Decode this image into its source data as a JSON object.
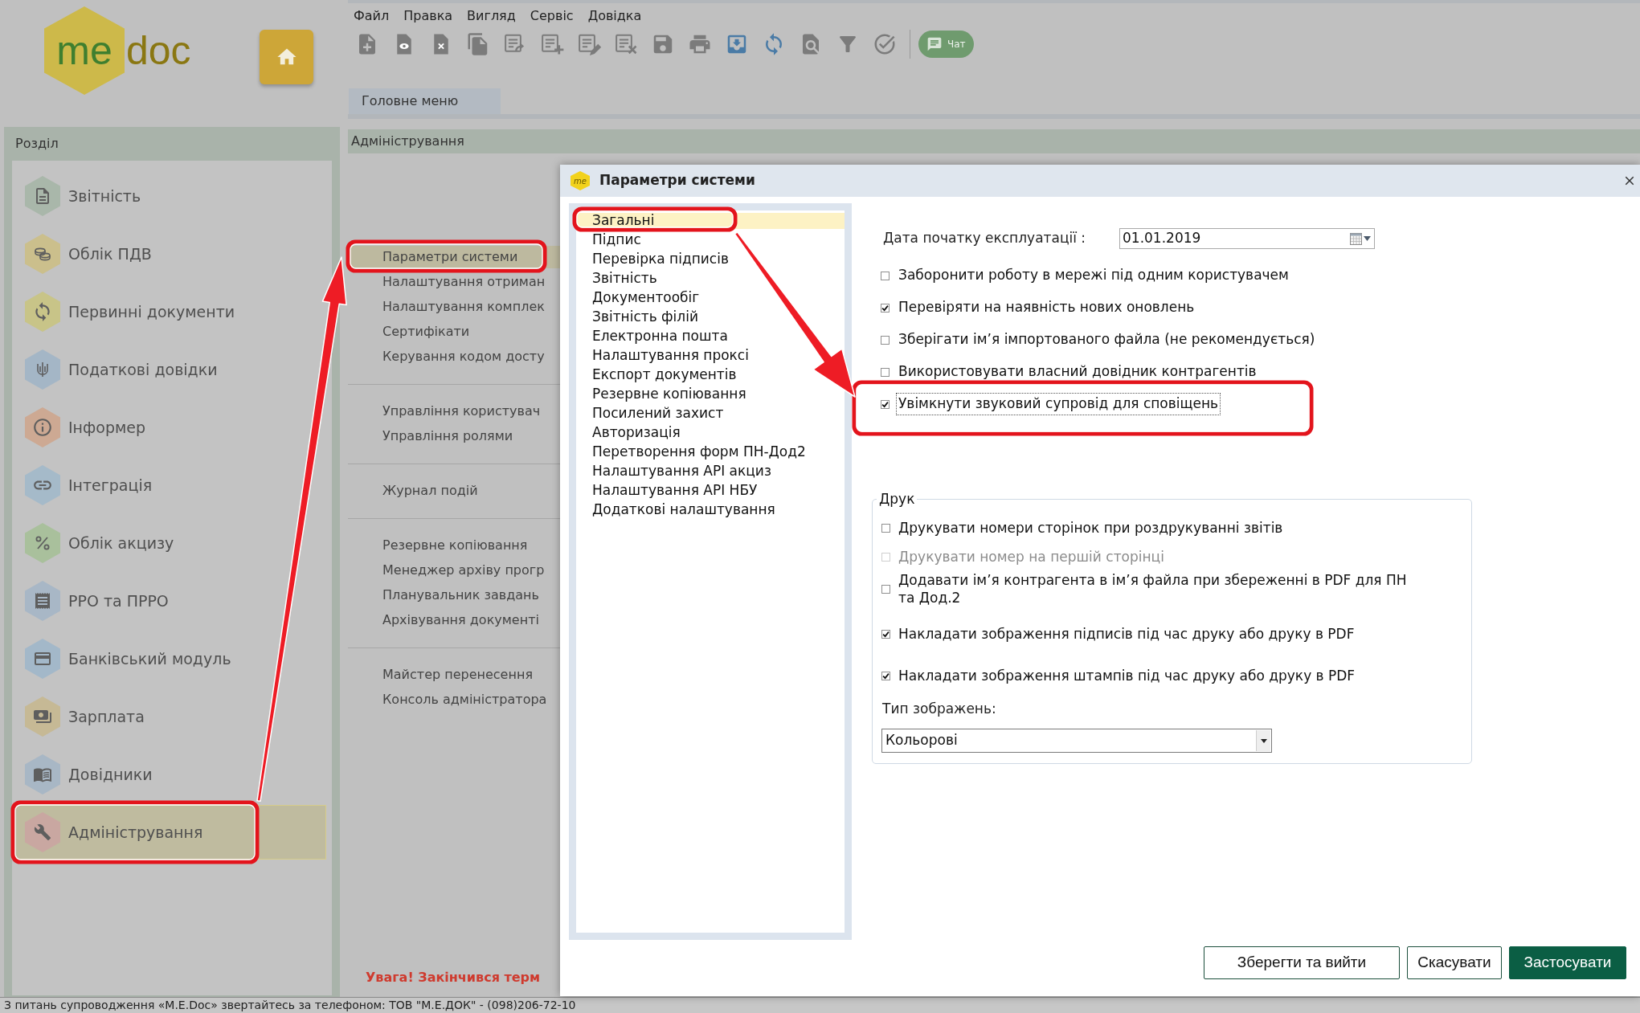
{
  "logo": {
    "text_1": "me",
    "text_2": "doc"
  },
  "menu_bar": [
    "Файл",
    "Правка",
    "Вигляд",
    "Сервіс",
    "Довідка"
  ],
  "toolbar": {
    "chat_button": "Чат"
  },
  "tabs": [
    {
      "label": "Головне меню",
      "selected": true
    }
  ],
  "sidebar": {
    "title": "Розділ",
    "items": [
      {
        "label": "Звітність",
        "selected": false,
        "color": "#a9b7aa"
      },
      {
        "label": "Облік ПДВ",
        "selected": false,
        "color": "#cbbf8c"
      },
      {
        "label": "Первинні документи",
        "selected": false,
        "color": "#c8c488"
      },
      {
        "label": "Податкові довідки",
        "selected": false,
        "color": "#a4b6c6"
      },
      {
        "label": "Інформер",
        "selected": false,
        "color": "#cda993"
      },
      {
        "label": "Інтеграція",
        "selected": false,
        "color": "#a5bac9"
      },
      {
        "label": "Облік акцизу",
        "selected": false,
        "color": "#a9c09c"
      },
      {
        "label": "РРО та ПРРО",
        "selected": false,
        "color": "#a8b7c6"
      },
      {
        "label": "Банківський модуль",
        "selected": false,
        "color": "#a3b8c9"
      },
      {
        "label": "Зарплата",
        "selected": false,
        "color": "#c6b995"
      },
      {
        "label": "Довідники",
        "selected": false,
        "color": "#a8b7c5"
      },
      {
        "label": "Адміністрування",
        "selected": true,
        "color": "#c9a7a1"
      }
    ]
  },
  "section_header": "Адміністрування",
  "admin_menu": {
    "groups": [
      {
        "items": [
          {
            "label": "Параметри системи",
            "selected": true
          },
          {
            "label": "Налаштування отриман",
            "selected": false
          },
          {
            "label": "Налаштування комплек",
            "selected": false
          },
          {
            "label": "Сертифікати",
            "selected": false
          },
          {
            "label": "Керування кодом досту",
            "selected": false
          }
        ]
      },
      {
        "items": [
          {
            "label": "Управління користувач",
            "selected": false
          },
          {
            "label": "Управління ролями",
            "selected": false
          }
        ]
      },
      {
        "items": [
          {
            "label": "Журнал подій",
            "selected": false
          }
        ]
      },
      {
        "items": [
          {
            "label": "Резервне копіювання",
            "selected": false
          },
          {
            "label": "Менеджер архіву прогр",
            "selected": false
          },
          {
            "label": "Планувальник завдань",
            "selected": false
          },
          {
            "label": "Архівування документі",
            "selected": false
          }
        ]
      },
      {
        "items": [
          {
            "label": "Майстер перенесення",
            "selected": false
          },
          {
            "label": "Консоль адміністратора",
            "selected": false
          }
        ]
      }
    ]
  },
  "warning": "Увага! Закінчився терм",
  "status_bar": "З питань супроводження «M.E.Doc» звертайтесь за телефоном: ТОВ \"М.Е.ДОК\" - (098)206-72-10",
  "dialog": {
    "icon_text": "me",
    "title": "Параметри системи",
    "categories": [
      {
        "label": "Загальні",
        "selected": true
      },
      {
        "label": "Підпис",
        "selected": false
      },
      {
        "label": "Перевірка підписів",
        "selected": false
      },
      {
        "label": "Звітність",
        "selected": false
      },
      {
        "label": "Документообіг",
        "selected": false
      },
      {
        "label": "Звітність філій",
        "selected": false
      },
      {
        "label": "Електронна пошта",
        "selected": false
      },
      {
        "label": "Налаштування проксі",
        "selected": false
      },
      {
        "label": "Експорт документів",
        "selected": false
      },
      {
        "label": "Резервне копіювання",
        "selected": false
      },
      {
        "label": "Посилений захист",
        "selected": false
      },
      {
        "label": "Авторизація",
        "selected": false
      },
      {
        "label": "Перетворення форм ПН-Дод2",
        "selected": false
      },
      {
        "label": "Налаштування API акциз",
        "selected": false
      },
      {
        "label": "Налаштування API НБУ",
        "selected": false
      },
      {
        "label": "Додаткові налаштування",
        "selected": false
      }
    ],
    "start_date": {
      "label": "Дата початку експлуатації :",
      "value": "01.01.2019"
    },
    "options": [
      {
        "label": "Заборонити роботу в мережі під одним користувачем",
        "checked": false,
        "focused": false
      },
      {
        "label": "Перевіряти на наявність нових оновлень",
        "checked": true,
        "focused": false
      },
      {
        "label": "Зберігати ім’я імпортованого файла (не рекомендується)",
        "checked": false,
        "focused": false
      },
      {
        "label": "Використовувати власний довідник контрагентів",
        "checked": false,
        "focused": false
      },
      {
        "label": "Увімкнути звуковий супровід для сповіщень",
        "checked": true,
        "focused": true
      }
    ],
    "print_group": {
      "title": "Друк",
      "options": [
        {
          "label": "Друкувати номери сторінок при роздрукуванні звітів",
          "checked": false,
          "disabled": false
        },
        {
          "label": "Друкувати номер на першій сторінці",
          "checked": false,
          "disabled": true
        },
        {
          "label": "Додавати ім’я контрагента в ім’я файла при збереженні в PDF для ПН та Дод.2",
          "checked": false,
          "disabled": false
        },
        {
          "label": "Накладати зображення підписів під час друку або друку в PDF",
          "checked": true,
          "disabled": false
        },
        {
          "label": "Накладати зображення штампів під час друку або друку в PDF",
          "checked": true,
          "disabled": false
        }
      ],
      "image_type": {
        "label": "Тип зображень:",
        "value": "Кольорові"
      }
    },
    "buttons": [
      {
        "label": "Зберегти та вийти",
        "kind": "secondary"
      },
      {
        "label": "Скасувати",
        "kind": "secondary"
      },
      {
        "label": "Застосувати",
        "kind": "primary"
      }
    ]
  }
}
